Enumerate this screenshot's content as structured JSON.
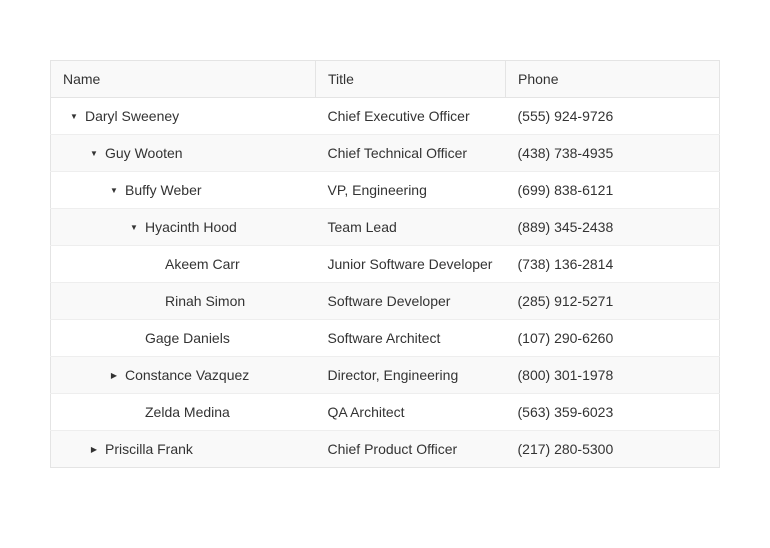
{
  "columns": {
    "name": "Name",
    "title": "Title",
    "phone": "Phone"
  },
  "rows": [
    {
      "level": 0,
      "expanded": true,
      "hasChildren": true,
      "name": "Daryl Sweeney",
      "title": "Chief Executive Officer",
      "phone": "(555) 924-9726"
    },
    {
      "level": 1,
      "expanded": true,
      "hasChildren": true,
      "name": "Guy Wooten",
      "title": "Chief Technical Officer",
      "phone": "(438) 738-4935"
    },
    {
      "level": 2,
      "expanded": true,
      "hasChildren": true,
      "name": "Buffy Weber",
      "title": "VP, Engineering",
      "phone": "(699) 838-6121"
    },
    {
      "level": 3,
      "expanded": true,
      "hasChildren": true,
      "name": "Hyacinth Hood",
      "title": "Team Lead",
      "phone": "(889) 345-2438"
    },
    {
      "level": 4,
      "expanded": false,
      "hasChildren": false,
      "name": "Akeem Carr",
      "title": "Junior Software Developer",
      "phone": "(738) 136-2814"
    },
    {
      "level": 4,
      "expanded": false,
      "hasChildren": false,
      "name": "Rinah Simon",
      "title": "Software Developer",
      "phone": "(285) 912-5271"
    },
    {
      "level": 3,
      "expanded": false,
      "hasChildren": false,
      "name": "Gage Daniels",
      "title": "Software Architect",
      "phone": "(107) 290-6260"
    },
    {
      "level": 2,
      "expanded": false,
      "hasChildren": true,
      "name": "Constance Vazquez",
      "title": "Director, Engineering",
      "phone": "(800) 301-1978"
    },
    {
      "level": 3,
      "expanded": false,
      "hasChildren": false,
      "name": "Zelda Medina",
      "title": "QA Architect",
      "phone": "(563) 359-6023"
    },
    {
      "level": 1,
      "expanded": false,
      "hasChildren": true,
      "name": "Priscilla Frank",
      "title": "Chief Product Officer",
      "phone": "(217) 280-5300"
    }
  ],
  "icons": {
    "expanded": "▼",
    "collapsed": "▶"
  },
  "indentPx": 20
}
